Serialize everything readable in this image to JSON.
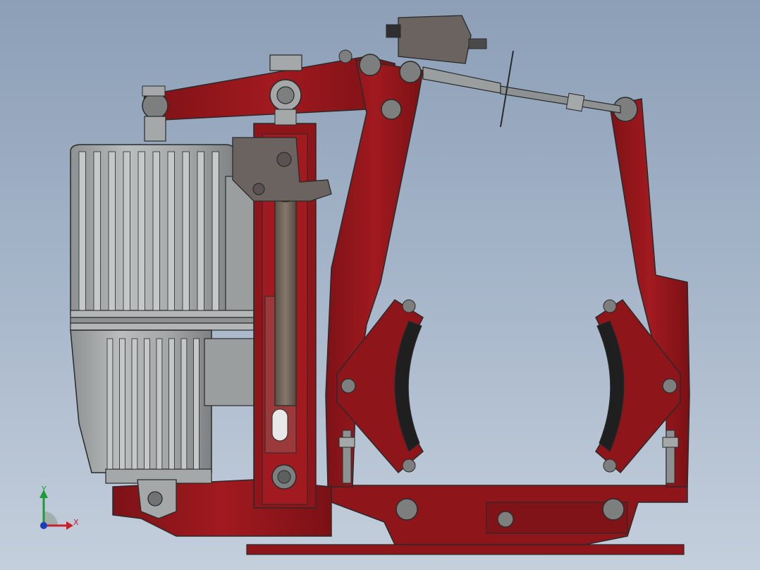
{
  "viewport": {
    "background_top": "#8c9fb7",
    "background_bottom": "#c4cfdc"
  },
  "model": {
    "frame_color": "#8e1519",
    "frame_shadow": "#5d0d10",
    "motor_color": "#a7abab",
    "motor_dark": "#7c8080",
    "rod_color": "#6e6155",
    "pad_color": "#1f1f1f",
    "edge_color": "#2a2a2a"
  },
  "triad": {
    "x_label": "X",
    "y_label": "Y",
    "x_color": "#c8202a",
    "y_color": "#1f9a3a",
    "z_color": "#1d3bb8"
  }
}
